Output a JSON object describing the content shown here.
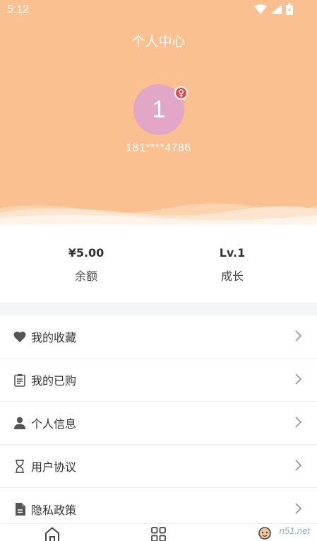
{
  "status_bar": {
    "time": "5:12"
  },
  "header": {
    "title": "个人中心",
    "avatar_text": "1",
    "gender_symbol": "♀",
    "phone": "181****4786",
    "bg_color": "#fac08f",
    "avatar_color": "#e2a6c6",
    "badge_color": "#e8444a"
  },
  "stats": [
    {
      "value": "¥5.00",
      "label": "余额"
    },
    {
      "value": "Lv.1",
      "label": "成长"
    }
  ],
  "menu": [
    {
      "label": "我的收藏",
      "icon": "heart-icon"
    },
    {
      "label": "我的已购",
      "icon": "clipboard-icon"
    },
    {
      "label": "个人信息",
      "icon": "person-icon"
    },
    {
      "label": "用户协议",
      "icon": "hourglass-icon"
    },
    {
      "label": "隐私政策",
      "icon": "document-icon"
    }
  ],
  "tabbar": {
    "icons": [
      "home-icon",
      "grid-icon",
      "profile-icon"
    ]
  },
  "watermark": "n51.net"
}
